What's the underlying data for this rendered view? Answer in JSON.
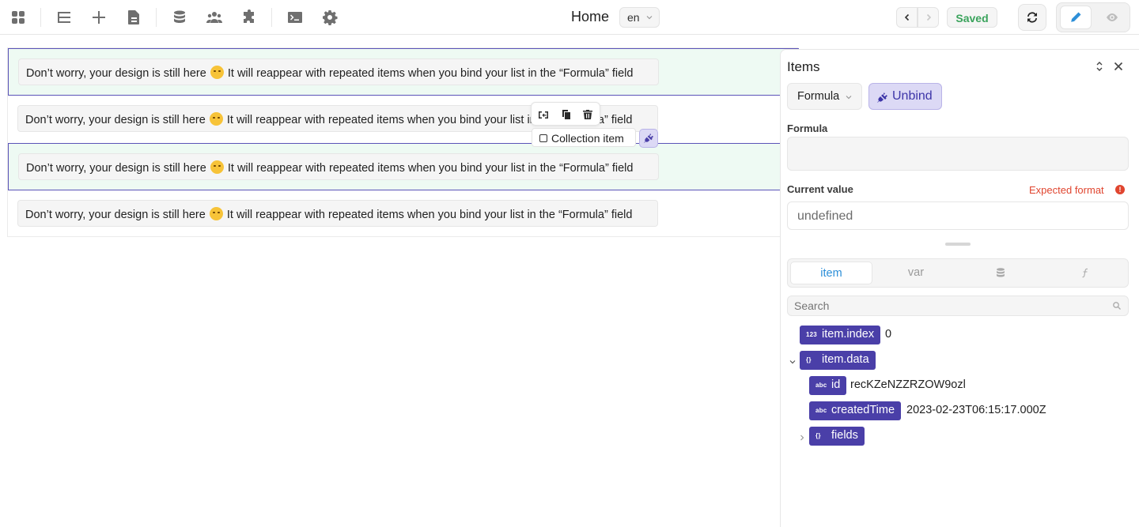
{
  "topbar": {
    "page_title": "Home",
    "language": "en",
    "saved_label": "Saved",
    "icons": [
      "apps-icon",
      "layers-icon",
      "add-icon",
      "pages-icon",
      "database-icon",
      "users-icon",
      "plugins-icon",
      "code-icon",
      "settings-icon"
    ]
  },
  "canvas": {
    "rows": [
      {
        "text_before": "Don’t worry, your design is still here",
        "text_after": "It will reappear with repeated items when you bind your list in the “Formula” field"
      },
      {
        "text_before": "Don’t worry, your design is still here",
        "text_after": "It will reappear with repeated items when you bind your list in the “Formula” field"
      },
      {
        "text_before": "Don’t worry, your design is still here",
        "text_after": "It will reappear with repeated items when you bind your list in the “Formula” field"
      },
      {
        "text_before": "Don’t worry, your design is still here",
        "text_after": "It will reappear with repeated items when you bind your list in the “Formula” field"
      }
    ],
    "item_label": "Collection item"
  },
  "panel": {
    "title": "Items",
    "mode_label": "Formula",
    "unbind_label": "Unbind",
    "formula_label": "Formula",
    "current_value_label": "Current value",
    "expected_format_label": "Expected format",
    "current_value": "undefined",
    "tabs": [
      {
        "label": "item"
      },
      {
        "label": "var"
      }
    ],
    "search_placeholder": "Search",
    "tree": {
      "index": {
        "type": "123",
        "label": "item.index",
        "value": "0"
      },
      "data": {
        "type": "{}",
        "label": "item.data"
      },
      "id": {
        "type": "abc",
        "label": "id",
        "value": "recKZeNZZRZOW9ozl"
      },
      "created": {
        "type": "abc",
        "label": "createdTime",
        "value": "2023-02-23T06:15:17.000Z"
      },
      "fields": {
        "type": "{}",
        "label": "fields"
      }
    }
  },
  "colors": {
    "accent": "#4a3fa8",
    "saved": "#3aa35c",
    "warning": "#e0452f",
    "tab_active": "#2d8fd8"
  }
}
